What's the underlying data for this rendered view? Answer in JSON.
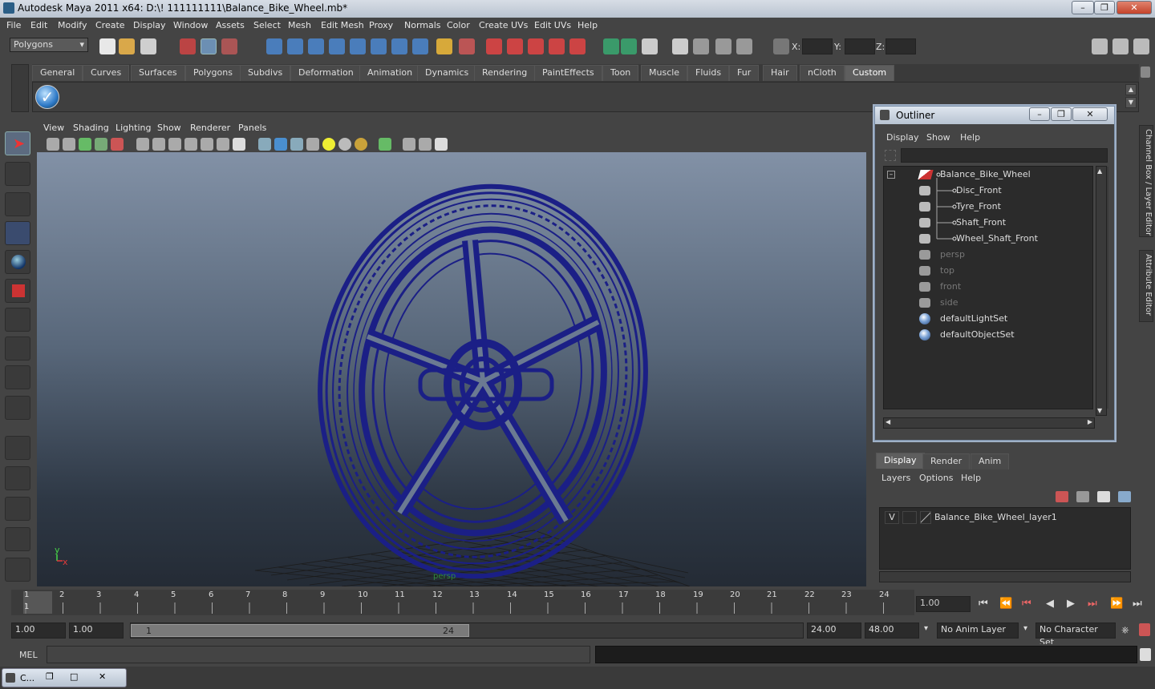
{
  "window": {
    "title": "Autodesk Maya 2011 x64: D:\\! 111111111\\Balance_Bike_Wheel.mb*"
  },
  "menubar": [
    "File",
    "Edit",
    "Modify",
    "Create",
    "Display",
    "Window",
    "Assets",
    "Select",
    "Mesh",
    "Edit Mesh",
    "Proxy",
    "Normals",
    "Color",
    "Create UVs",
    "Edit UVs",
    "Help"
  ],
  "toolbar": {
    "mode": "Polygons",
    "x_label": "X:",
    "y_label": "Y:",
    "z_label": "Z:"
  },
  "shelf_tabs": [
    "General",
    "Curves",
    "Surfaces",
    "Polygons",
    "Subdivs",
    "Deformation",
    "Animation",
    "Dynamics",
    "Rendering",
    "PaintEffects",
    "Toon",
    "Muscle",
    "Fluids",
    "Fur",
    "Hair",
    "nCloth",
    "Custom"
  ],
  "shelf_active": "Custom",
  "viewport": {
    "menu": [
      "View",
      "Shading",
      "Lighting",
      "Show",
      "Renderer",
      "Panels"
    ],
    "camera_label": "persp",
    "axis_y": "y",
    "axis_x": "x",
    "wire_color": "#1b1f86"
  },
  "outliner": {
    "title": "Outliner",
    "menu": [
      "Display",
      "Show",
      "Help"
    ],
    "items": [
      {
        "label": "Balance_Bike_Wheel",
        "icon": "group-icon",
        "dim": false
      },
      {
        "label": "Disc_Front",
        "icon": "mesh-icon",
        "dim": false
      },
      {
        "label": "Tyre_Front",
        "icon": "mesh-icon",
        "dim": false
      },
      {
        "label": "Shaft_Front",
        "icon": "mesh-icon",
        "dim": false
      },
      {
        "label": "Wheel_Shaft_Front",
        "icon": "mesh-icon",
        "dim": false
      },
      {
        "label": "persp",
        "icon": "camera-icon",
        "dim": true
      },
      {
        "label": "top",
        "icon": "camera-icon",
        "dim": true
      },
      {
        "label": "front",
        "icon": "camera-icon",
        "dim": true
      },
      {
        "label": "side",
        "icon": "camera-icon",
        "dim": true
      },
      {
        "label": "defaultLightSet",
        "icon": "set-icon",
        "dim": false
      },
      {
        "label": "defaultObjectSet",
        "icon": "set-icon",
        "dim": false
      }
    ]
  },
  "side_tabs": [
    "Channel Box / Layer Editor",
    "Attribute Editor"
  ],
  "layers": {
    "tabs": [
      "Display",
      "Render",
      "Anim"
    ],
    "menu": [
      "Layers",
      "Options",
      "Help"
    ],
    "layer": {
      "visible": "V",
      "name": "Balance_Bike_Wheel_layer1"
    }
  },
  "timeline": {
    "ticks": [
      "1",
      "2",
      "3",
      "4",
      "5",
      "6",
      "7",
      "8",
      "9",
      "10",
      "11",
      "12",
      "13",
      "14",
      "15",
      "16",
      "17",
      "18",
      "19",
      "20",
      "21",
      "22",
      "23",
      "24"
    ],
    "current_frame": "1",
    "current_time": "1.00"
  },
  "range": {
    "start": "1.00",
    "playback_start": "1.00",
    "slider_start": "1",
    "slider_end": "24",
    "playback_end": "24.00",
    "end": "48.00",
    "anim_layer": "No Anim Layer",
    "char_set": "No Character Set"
  },
  "cmdline": {
    "label": "MEL"
  },
  "taskbar": {
    "item": "C..."
  }
}
